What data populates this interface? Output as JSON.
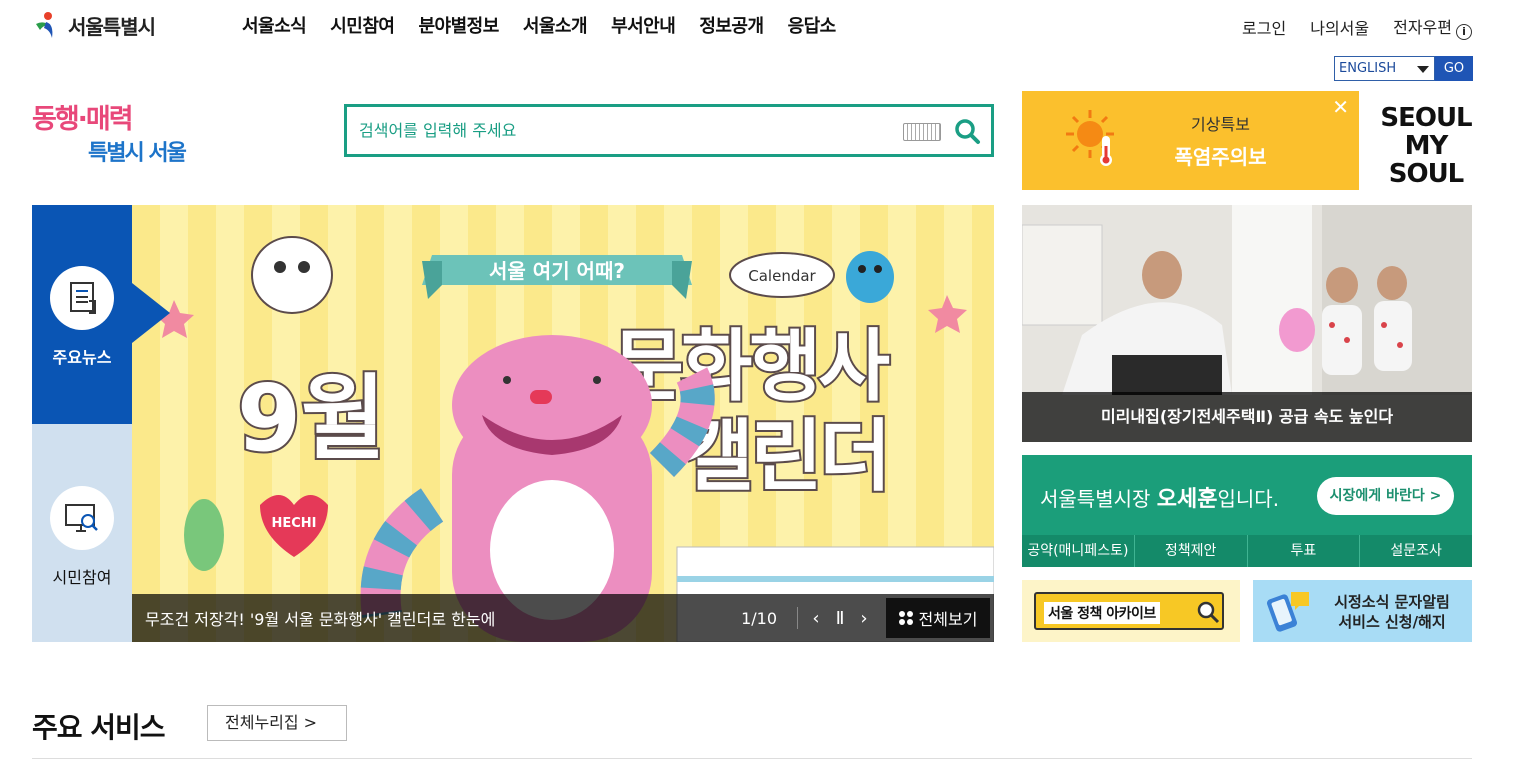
{
  "header": {
    "logo_text": "서울특별시",
    "nav": [
      "서울소식",
      "시민참여",
      "분야별정보",
      "서울소개",
      "부서안내",
      "정보공개",
      "응답소"
    ],
    "util": {
      "login": "로그인",
      "my_seoul": "나의서울",
      "email": "전자우편"
    }
  },
  "language": {
    "selected": "ENGLISH",
    "go": "GO"
  },
  "slogan": {
    "line1": "동행·매력",
    "line2": "특별시 서울"
  },
  "search": {
    "placeholder": "검색어를 입력해 주세요"
  },
  "weather": {
    "title": "기상특보",
    "value": "폭염주의보"
  },
  "brand": {
    "line1": "SEOUL",
    "line2": "MY SOUL"
  },
  "side_tabs": [
    {
      "label": "주요뉴스",
      "icon": "newspaper-icon"
    },
    {
      "label": "시민참여",
      "icon": "monitor-search-icon"
    }
  ],
  "banner": {
    "bubble": "서울 여기 어때?",
    "calendar_label": "Calendar",
    "month": "9월",
    "headline1": "문화행사",
    "headline2": "캘린더",
    "tag": "HECHI",
    "caption": "무조건 저장각! '9월 서울 문화행사' 캘린더로 한눈에",
    "pager": "1/10",
    "view_all": "전체보기"
  },
  "photo_news": {
    "caption": "미리내집(장기전세주택Ⅱ) 공급 속도 높인다"
  },
  "mayor": {
    "title_prefix": "서울특별시장",
    "name": "오세훈",
    "title_suffix": "입니다.",
    "button": "시장에게 바란다 >",
    "tabs": [
      "공약(매니페스토)",
      "정책제안",
      "투표",
      "설문조사"
    ]
  },
  "archive": {
    "label": "서울 정책 아카이브"
  },
  "sms": {
    "line1": "시정소식 문자알림",
    "line2": "서비스 신청/해지"
  },
  "services": {
    "title": "주요 서비스",
    "all": "전체누리집 >"
  },
  "colors": {
    "primary_blue": "#0a55b4",
    "search_green": "#1a9e84",
    "weather_yellow": "#fbc02d",
    "mayor_green": "#1b9e7a"
  }
}
